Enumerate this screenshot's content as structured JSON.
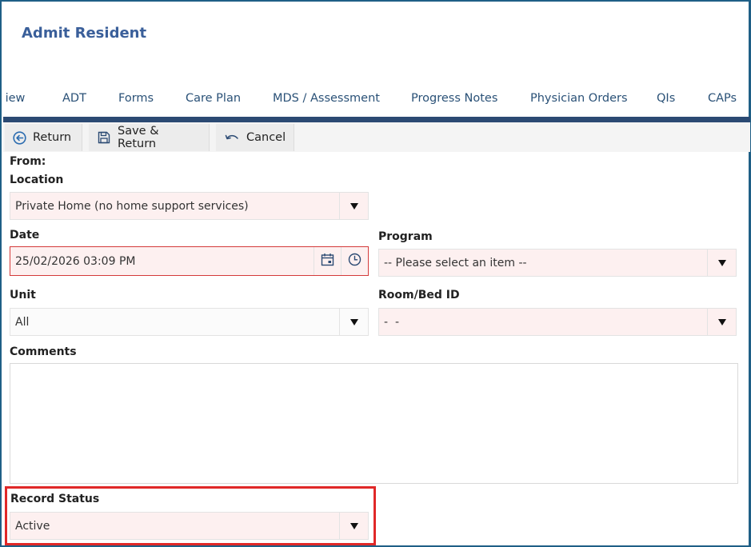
{
  "app": {
    "title": "Admit Resident"
  },
  "tabs": [
    {
      "label": "view"
    },
    {
      "label": "ADT"
    },
    {
      "label": "Forms"
    },
    {
      "label": "Care Plan"
    },
    {
      "label": "MDS / Assessment"
    },
    {
      "label": "Progress Notes"
    },
    {
      "label": "Physician Orders"
    },
    {
      "label": "QIs"
    },
    {
      "label": "CAPs"
    }
  ],
  "toolbar": {
    "return_label": "Return",
    "save_return_label": "Save & Return",
    "cancel_label": "Cancel"
  },
  "form": {
    "from_label": "From:",
    "location": {
      "label": "Location",
      "value": "Private Home (no home support services)"
    },
    "date": {
      "label": "Date",
      "value": "25/02/2026 03:09 PM"
    },
    "program": {
      "label": "Program",
      "value": "-- Please select an item --"
    },
    "unit": {
      "label": "Unit",
      "value": "All"
    },
    "room_bed": {
      "label": "Room/Bed ID",
      "value": "-  -"
    },
    "comments": {
      "label": "Comments",
      "value": ""
    },
    "record_status": {
      "label": "Record Status",
      "value": "Active"
    }
  },
  "colors": {
    "title": "#3a5f9a",
    "tab_text": "#2a5177",
    "tab_bar": "#2b4a73",
    "field_bg": "#fdf0f0",
    "error_border": "#d43a3a",
    "highlight": "#e02828"
  },
  "icons": {
    "return": "return-arrow-circle-icon",
    "save": "save-disk-icon",
    "cancel": "undo-arrow-icon",
    "calendar": "calendar-icon",
    "clock": "clock-icon",
    "dropdown": "triangle-down-icon"
  }
}
